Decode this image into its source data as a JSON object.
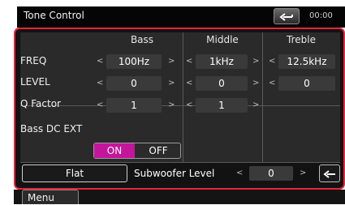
{
  "header": {
    "title": "Tone Control",
    "time": "00:00"
  },
  "tone_table": {
    "columns": [
      "Bass",
      "Middle",
      "Treble"
    ],
    "rows": [
      {
        "label": "FREQ",
        "values": [
          "100Hz",
          "1kHz",
          "12.5kHz"
        ]
      },
      {
        "label": "LEVEL",
        "values": [
          "0",
          "0",
          "0"
        ]
      },
      {
        "label": "Q Factor",
        "values": [
          "1",
          "1",
          ""
        ]
      }
    ]
  },
  "bass_dc_ext": {
    "label": "Bass DC EXT",
    "on_label": "ON",
    "off_label": "OFF",
    "selected": "ON"
  },
  "bottom": {
    "flat_label": "Flat",
    "subwoofer_label": "Subwoofer Level",
    "subwoofer_value": "0"
  },
  "menu": {
    "label": "Menu"
  },
  "colors": {
    "accent_red": "#e8243a",
    "toggle_on": "#c4169a"
  }
}
